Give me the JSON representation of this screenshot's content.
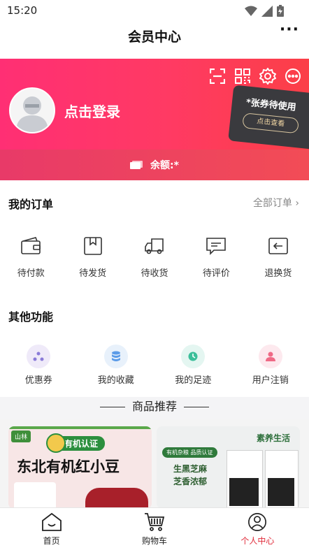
{
  "status": {
    "time": "15:20"
  },
  "nav": {
    "title": "会员中心",
    "more": "···"
  },
  "banner": {
    "login": "点击登录",
    "ticket_text": "*张券待使用",
    "ticket_button": "点击查看",
    "balance": "余额:*"
  },
  "orders": {
    "title": "我的订单",
    "all": "全部订单 ›",
    "items": [
      {
        "label": "待付款",
        "icon": "wallet-icon"
      },
      {
        "label": "待发货",
        "icon": "box-icon"
      },
      {
        "label": "待收货",
        "icon": "truck-icon"
      },
      {
        "label": "待评价",
        "icon": "comment-icon"
      },
      {
        "label": "退换货",
        "icon": "return-icon"
      }
    ]
  },
  "functions": {
    "title": "其他功能",
    "items": [
      {
        "label": "优惠券",
        "icon": "coupon-icon",
        "color": "#efeaf9"
      },
      {
        "label": "我的收藏",
        "icon": "favorite-icon",
        "color": "#e8f1fb"
      },
      {
        "label": "我的足迹",
        "icon": "footprint-icon",
        "color": "#e4f6f1"
      },
      {
        "label": "用户注销",
        "icon": "user-cancel-icon",
        "color": "#fde9ee"
      }
    ]
  },
  "recommend": {
    "title": "商品推荐",
    "products": [
      {
        "badge": "有机认证",
        "name": "东北有机红小豆",
        "brand": "山林"
      },
      {
        "brand": "素养生活",
        "line1": "生黑芝麻",
        "line2": "芝香浓郁",
        "cert": "有机杂粮 品质认证"
      }
    ]
  },
  "tabbar": {
    "items": [
      {
        "label": "首页",
        "icon": "home-icon"
      },
      {
        "label": "购物车",
        "icon": "cart-icon"
      },
      {
        "label": "个人中心",
        "icon": "profile-icon"
      }
    ]
  },
  "colors": {
    "accent": "#e02b3a",
    "banner_start": "#ff2f74",
    "banner_end": "#fb3f47"
  }
}
